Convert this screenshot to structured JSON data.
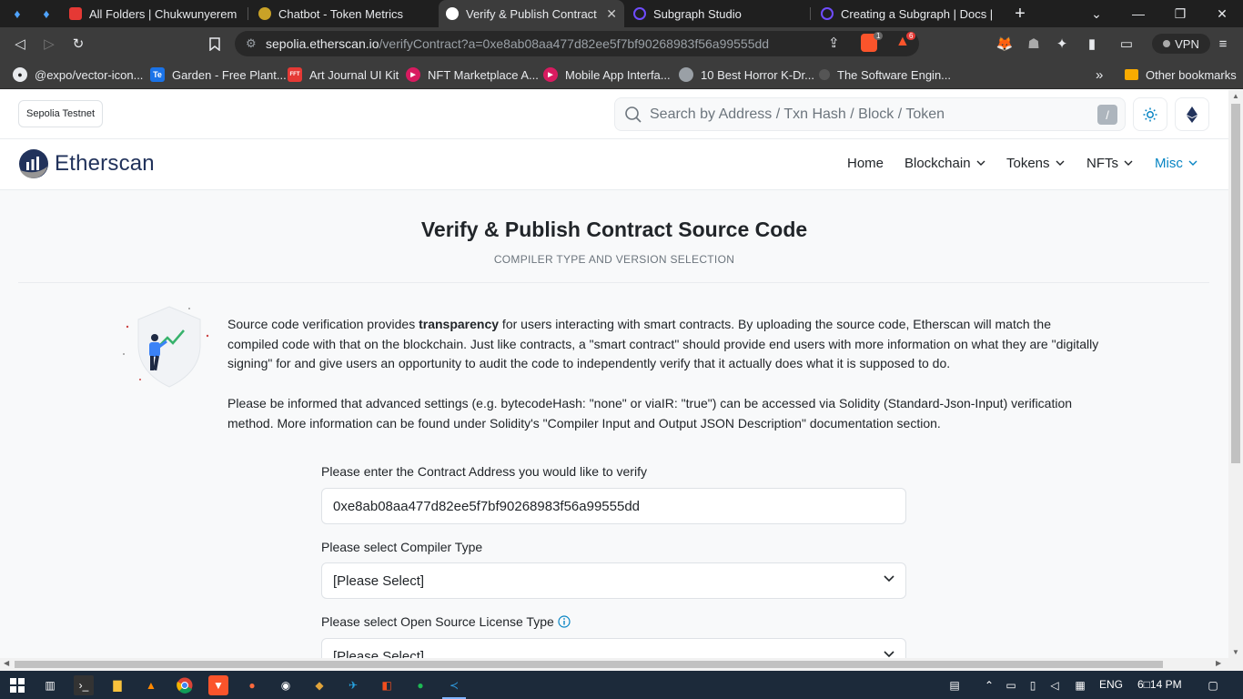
{
  "browser": {
    "tabs": [
      {
        "title": "All Folders | Chukwunyerem's W",
        "active": false
      },
      {
        "title": "Chatbot - Token Metrics",
        "active": false
      },
      {
        "title": "Verify & Publish Contract So",
        "active": true
      },
      {
        "title": "Subgraph Studio",
        "active": false
      },
      {
        "title": "Creating a Subgraph | Docs | Th",
        "active": false
      }
    ],
    "new_tab_symbol": "+",
    "url_domain": "sepolia.etherscan.io",
    "url_path": "/verifyContract?a=0xe8ab08aa477d82ee5f7bf90268983f56a99555dd",
    "shield_count": "1",
    "alert_count": "6",
    "vpn_label": "VPN",
    "bookmarks": [
      {
        "label": "@expo/vector-icon...",
        "icon": "github-icon",
        "badge": "",
        "color": "#e8eaed"
      },
      {
        "label": "Garden - Free Plant...",
        "icon": "te-icon",
        "badge": "Te",
        "color": "#1a73e8"
      },
      {
        "label": "Art Journal UI Kit",
        "icon": "figma-red-icon",
        "badge": "FFT",
        "color": "#e53935"
      },
      {
        "label": "NFT Marketplace A...",
        "icon": "play-icon",
        "badge": "▶",
        "color": "#d81b60"
      },
      {
        "label": "Mobile App Interfa...",
        "icon": "play-icon",
        "badge": "▶",
        "color": "#d81b60"
      },
      {
        "label": "10 Best Horror K-Dr...",
        "icon": "globe-icon",
        "badge": "",
        "color": "#9aa0a6"
      },
      {
        "label": "The Software Engin...",
        "icon": "dot-icon",
        "badge": "",
        "color": "#555"
      }
    ],
    "more_bookmarks": "»",
    "other_bookmarks": "Other bookmarks"
  },
  "header": {
    "network_badge": "Sepolia Testnet",
    "search_placeholder": "Search by Address / Txn Hash / Block / Token",
    "search_shortcut": "/",
    "logo_text": "Etherscan",
    "nav": [
      {
        "label": "Home",
        "has_dropdown": false,
        "active": false
      },
      {
        "label": "Blockchain",
        "has_dropdown": true,
        "active": false
      },
      {
        "label": "Tokens",
        "has_dropdown": true,
        "active": false
      },
      {
        "label": "NFTs",
        "has_dropdown": true,
        "active": false
      },
      {
        "label": "Misc",
        "has_dropdown": true,
        "active": true
      }
    ]
  },
  "main": {
    "title": "Verify & Publish Contract Source Code",
    "subtitle": "COMPILER TYPE AND VERSION SELECTION",
    "intro_pre": "Source code verification provides ",
    "intro_bold": "transparency",
    "intro_post": " for users interacting with smart contracts. By uploading the source code, Etherscan will match the compiled code with that on the blockchain. Just like contracts, a \"smart contract\" should provide end users with more information on what they are \"digitally signing\" for and give users an opportunity to audit the code to independently verify that it actually does what it is supposed to do.",
    "note": "Please be informed that advanced settings (e.g. bytecodeHash: \"none\" or viaIR: \"true\") can be accessed via Solidity (Standard-Json-Input) verification method. More information can be found under Solidity's \"Compiler Input and Output JSON Description\" documentation section.",
    "address_label": "Please enter the Contract Address you would like to verify",
    "address_value": "0xe8ab08aa477d82ee5f7bf90268983f56a99555dd",
    "compiler_label": "Please select Compiler Type",
    "compiler_value": "[Please Select]",
    "license_label": "Please select Open Source License Type",
    "license_value": "[Please Select]"
  },
  "taskbar": {
    "lang": "ENG",
    "time": "6□14 PM"
  },
  "colors": {
    "accent": "#0784c3",
    "logo_navy": "#21325b",
    "text": "#212529",
    "muted": "#6c757d"
  }
}
